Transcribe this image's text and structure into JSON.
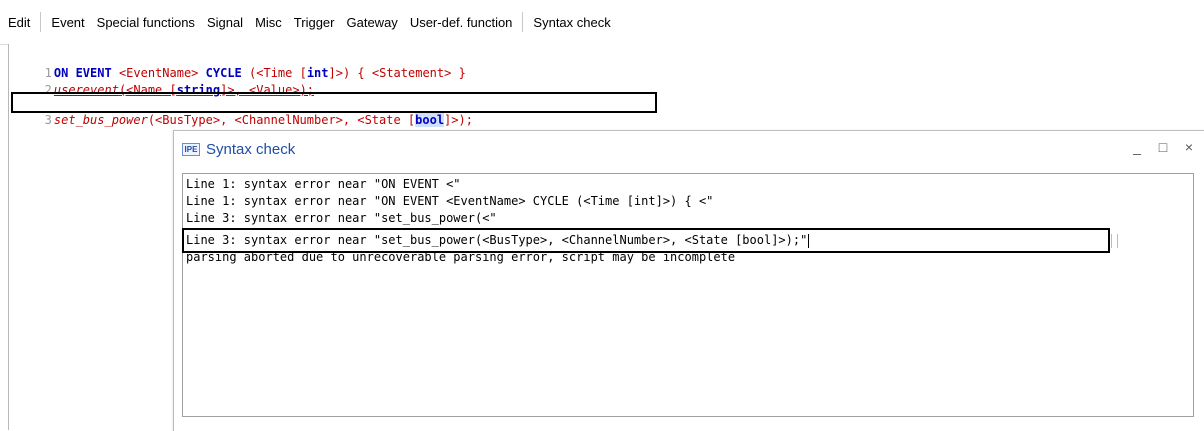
{
  "menubar": {
    "items": [
      "Edit",
      "Event",
      "Special functions",
      "Signal",
      "Misc",
      "Trigger",
      "Gateway",
      "User-def. function",
      "Syntax check"
    ]
  },
  "editor": {
    "line1": {
      "num": "1",
      "kw_on_event": "ON EVENT",
      "p_eventname": "<EventName>",
      "kw_cycle": "CYCLE",
      "p_paren_open": "(<Time [",
      "t_int": "int",
      "p_paren_close": "]>)",
      "p_brace": "{ <Statement> }"
    },
    "line2": {
      "num": "2",
      "fn": "userevent",
      "p_open": "(<Name [",
      "t_string": "string",
      "p_close": "]>, <Value>);"
    },
    "line3": {
      "num": "3",
      "fn": "set_bus_power",
      "p_args": "(<BusType>, <ChannelNumber>, <State [",
      "t_bool": "bool",
      "p_close": "]>);"
    }
  },
  "dialog": {
    "icon_text": "IPE",
    "title": "Syntax check",
    "minimize": "_",
    "maximize": "□",
    "close": "×",
    "output_lines": [
      "Line 1: syntax error near \"ON EVENT <\"",
      "Line 1: syntax error near \"ON EVENT <EventName> CYCLE (<Time [int]>) { <\"",
      "Line 3: syntax error near \"set_bus_power(<\"",
      "Line 3: syntax error near \"set_bus_power(<BusType>, <ChannelNumber>, <State [bool]>);\"",
      "parsing aborted due to unrecoverable parsing error, script may be incomplete"
    ]
  }
}
